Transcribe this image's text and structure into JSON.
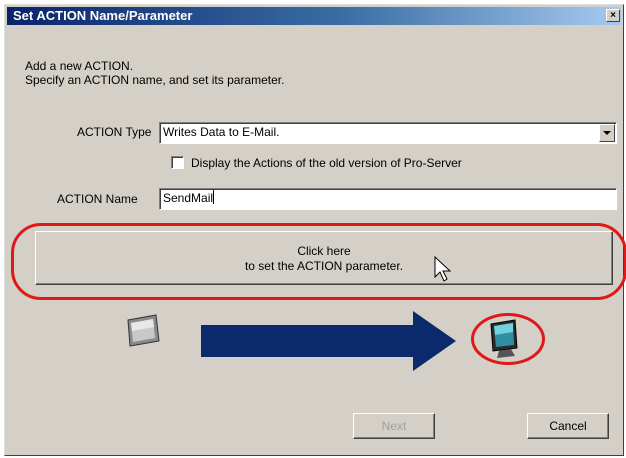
{
  "dialog": {
    "title": "Set ACTION Name/Parameter",
    "close_label": "×",
    "instructions": [
      "Add a new ACTION.",
      "Specify an ACTION name, and set its parameter."
    ]
  },
  "form": {
    "action_type_label": "ACTION Type",
    "action_type_value": "Writes Data to E-Mail.",
    "old_version_checkbox_label": "Display the Actions of the old version of Pro-Server",
    "old_version_checked": false,
    "action_name_label": "ACTION Name",
    "action_name_value": "SendMail"
  },
  "param_button": {
    "line1": "Click here",
    "line2": "to set the ACTION parameter."
  },
  "footer": {
    "next_label": "Next",
    "cancel_label": "Cancel"
  },
  "icons": [
    "monitor-icon",
    "arrow-right-icon",
    "display-station-icon",
    "mouse-pointer-icon"
  ],
  "colors": {
    "highlight": "#e01818",
    "arrow": "#0b2a6b",
    "title_bar_start": "#0a246a",
    "dialog_bg": "#d4d0c8"
  }
}
